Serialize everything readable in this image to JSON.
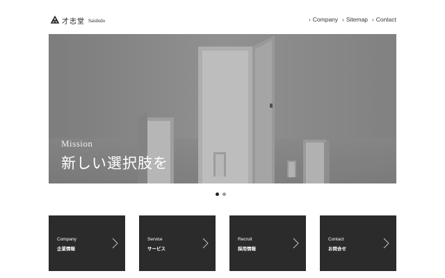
{
  "header": {
    "logo_jp": "才志堂",
    "logo_en": "Saishido",
    "logo_icon": "brush-emblem-icon",
    "nav": [
      {
        "label": "Company"
      },
      {
        "label": "Sitemap"
      },
      {
        "label": "Contact"
      }
    ]
  },
  "hero": {
    "label": "Mission",
    "title": "新しい選択肢を",
    "slides_total": 2,
    "slide_active": 1
  },
  "cards": [
    {
      "en": "Company",
      "jp": "企業情報"
    },
    {
      "en": "Service",
      "jp": "サービス"
    },
    {
      "en": "Recruit",
      "jp": "採用情報"
    },
    {
      "en": "Contact",
      "jp": "お問合せ"
    }
  ],
  "colors": {
    "card_bg": "#2b2b2b",
    "hero_bg": "#8f8f8f",
    "dot_active": "#222222",
    "dot_inactive": "#9a9a9a"
  }
}
